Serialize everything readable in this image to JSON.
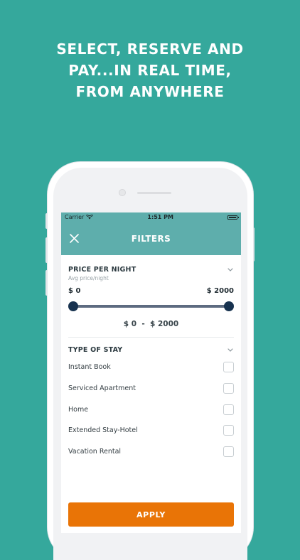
{
  "headline": {
    "line1": "SELECT, RESERVE AND",
    "line2": "PAY...IN REAL TIME,",
    "line3": "FROM ANYWHERE"
  },
  "status_bar": {
    "carrier": "Carrier",
    "time": "1:51 PM"
  },
  "nav": {
    "title": "FILTERS"
  },
  "price_section": {
    "title": "PRICE PER NIGHT",
    "subtitle": "Avg price/night",
    "min_label": "$ 0",
    "max_label": "$ 2000",
    "range_display": "$ 0  -  $ 2000",
    "range_min_value": 0,
    "range_max_value": 2000
  },
  "stay_section": {
    "title": "TYPE OF STAY",
    "options": [
      {
        "label": "Instant Book",
        "checked": false
      },
      {
        "label": "Serviced Apartment",
        "checked": false
      },
      {
        "label": "Home",
        "checked": false
      },
      {
        "label": "Extended Stay-Hotel",
        "checked": false
      },
      {
        "label": "Vacation Rental",
        "checked": false
      }
    ]
  },
  "apply_label": "APPLY",
  "colors": {
    "background": "#35a89c",
    "header": "#5eaeac",
    "accent": "#e97406",
    "slider_knob": "#17324f"
  }
}
